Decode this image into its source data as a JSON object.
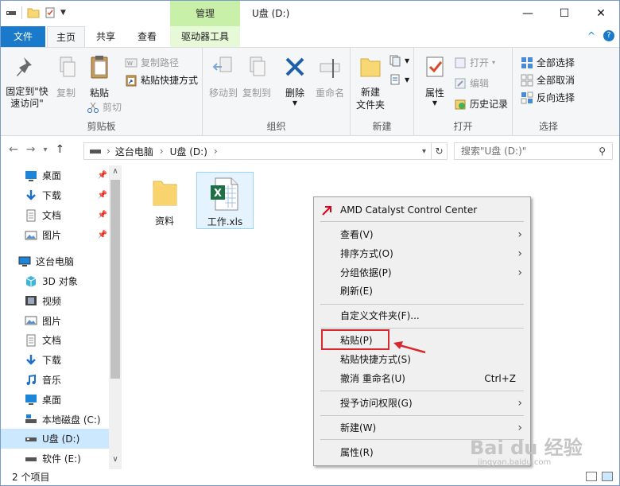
{
  "titlebar": {
    "manage_tab": "管理",
    "title": "U盘 (D:)",
    "minimize": "—",
    "maximize": "☐",
    "close": "✕"
  },
  "tabs": {
    "file": "文件",
    "home": "主页",
    "share": "共享",
    "view": "查看",
    "drive_tools": "驱动器工具",
    "collapse": "^",
    "help": "?"
  },
  "ribbon": {
    "clipboard": {
      "label": "剪贴板",
      "pin_quick": "固定到\"快\n速访问\"",
      "copy": "复制",
      "paste": "粘贴",
      "copy_path": "复制路径",
      "paste_shortcut": "粘贴快捷方式",
      "cut": "剪切"
    },
    "organize": {
      "label": "组织",
      "move_to": "移动到",
      "copy_to": "复制到",
      "delete": "删除",
      "rename": "重命名"
    },
    "new": {
      "label": "新建",
      "new_folder": "新建\n文件夹"
    },
    "open": {
      "label": "打开",
      "properties": "属性",
      "open": "打开",
      "edit": "编辑",
      "history": "历史记录"
    },
    "select": {
      "label": "选择",
      "select_all": "全部选择",
      "select_none": "全部取消",
      "invert": "反向选择"
    }
  },
  "address": {
    "path_root": "这台电脑",
    "path_drive": "U盘 (D:)",
    "search_placeholder": "搜索\"U盘 (D:)\""
  },
  "navpane": {
    "quick": [
      {
        "label": "桌面",
        "icon": "desktop-icon"
      },
      {
        "label": "下载",
        "icon": "download-icon"
      },
      {
        "label": "文档",
        "icon": "document-icon"
      },
      {
        "label": "图片",
        "icon": "picture-icon"
      }
    ],
    "thispc": "这台电脑",
    "pc_items": [
      {
        "label": "3D 对象",
        "icon": "3d-objects-icon"
      },
      {
        "label": "视频",
        "icon": "video-icon"
      },
      {
        "label": "图片",
        "icon": "picture-icon"
      },
      {
        "label": "文档",
        "icon": "document-icon"
      },
      {
        "label": "下载",
        "icon": "download-icon"
      },
      {
        "label": "音乐",
        "icon": "music-icon"
      },
      {
        "label": "桌面",
        "icon": "desktop-icon"
      },
      {
        "label": "本地磁盘 (C:)",
        "icon": "local-disk-icon"
      },
      {
        "label": "U盘 (D:)",
        "icon": "usb-drive-icon"
      },
      {
        "label": "软件 (E:)",
        "icon": "drive-icon"
      }
    ]
  },
  "files": [
    {
      "name": "资料",
      "type": "folder"
    },
    {
      "name": "工作.xls",
      "type": "excel"
    }
  ],
  "status": {
    "count": "2 个项目"
  },
  "context_menu": {
    "amd": "AMD Catalyst Control Center",
    "view": "查看(V)",
    "sort": "排序方式(O)",
    "group": "分组依据(P)",
    "refresh": "刷新(E)",
    "customize": "自定义文件夹(F)...",
    "paste": "粘贴(P)",
    "paste_shortcut": "粘贴快捷方式(S)",
    "undo": "撤消 重命名(U)",
    "undo_shortcut": "Ctrl+Z",
    "grant": "授予访问权限(G)",
    "new": "新建(W)",
    "properties": "属性(R)"
  },
  "watermark": {
    "brand": "Bai du 经验",
    "sub": "jingyan.baidu.com"
  },
  "colors": {
    "accent": "#1979ca",
    "manage_tab": "#c8f0a8",
    "selection": "#cce8ff",
    "highlight_box": "#d9272e"
  }
}
